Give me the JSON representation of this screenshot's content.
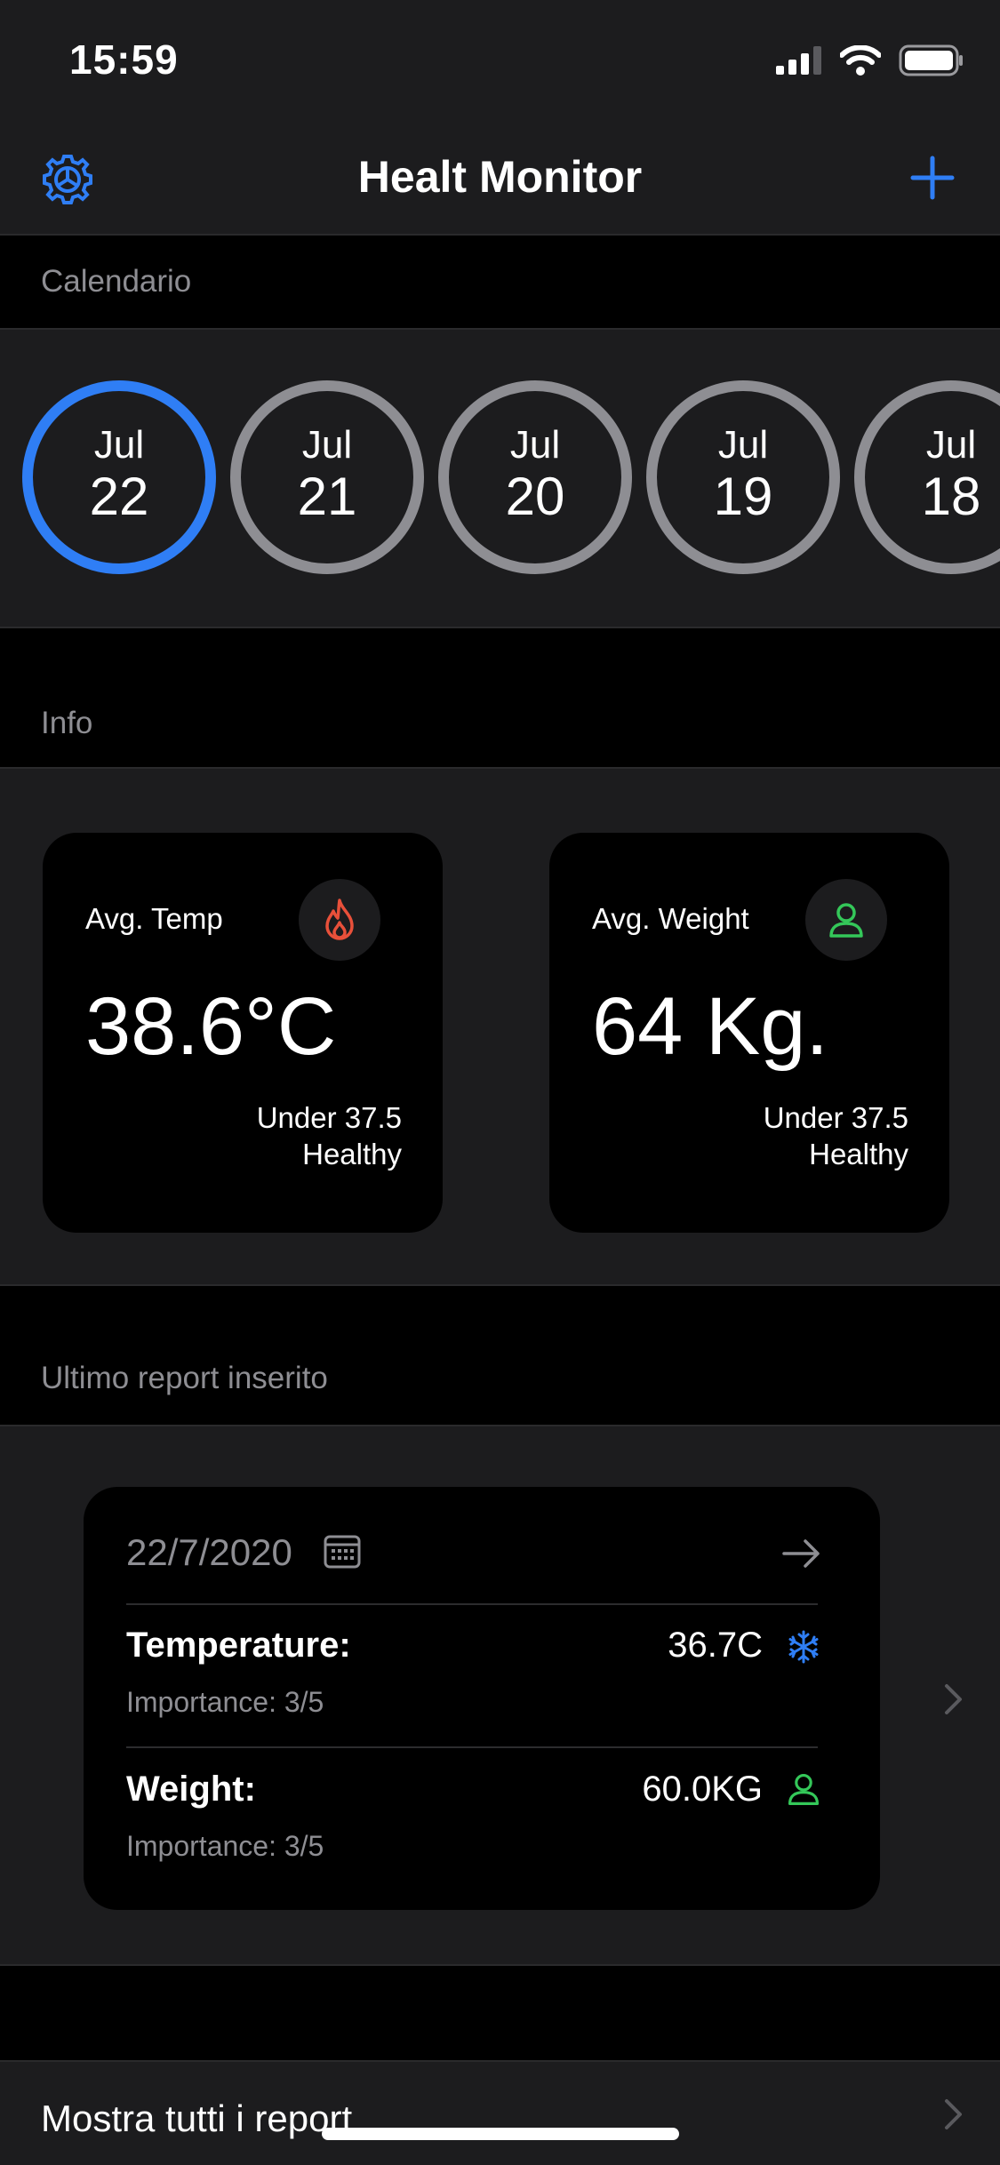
{
  "status": {
    "time": "15:59"
  },
  "nav": {
    "title": "Healt Monitor"
  },
  "calendar": {
    "header": "Calendario",
    "dates": [
      {
        "month": "Jul",
        "day": "22",
        "selected": true
      },
      {
        "month": "Jul",
        "day": "21",
        "selected": false
      },
      {
        "month": "Jul",
        "day": "20",
        "selected": false
      },
      {
        "month": "Jul",
        "day": "19",
        "selected": false
      },
      {
        "month": "Jul",
        "day": "18",
        "selected": false
      }
    ]
  },
  "info": {
    "header": "Info",
    "temp": {
      "label": "Avg. Temp",
      "value": "38.6°C",
      "note1": "Under 37.5",
      "note2": "Healthy",
      "icon": "flame-icon",
      "color": "#e8503a"
    },
    "weight": {
      "label": "Avg. Weight",
      "value": "64 Kg.",
      "note1": "Under 37.5",
      "note2": "Healthy",
      "icon": "person-icon",
      "color": "#34c759"
    }
  },
  "report": {
    "header": "Ultimo report inserito",
    "date": "22/7/2020",
    "temperature": {
      "label": "Temperature:",
      "value": "36.7C",
      "importance": "Importance: 3/5",
      "icon": "snowflake-icon"
    },
    "weight": {
      "label": "Weight:",
      "value": "60.0KG",
      "importance": "Importance: 3/5",
      "icon": "person-icon"
    }
  },
  "footer": {
    "show_all": "Mostra tutti i report"
  },
  "colors": {
    "accent": "#2f7ef5",
    "inactive": "#8e8e93",
    "green": "#34c759",
    "red": "#e8503a"
  }
}
